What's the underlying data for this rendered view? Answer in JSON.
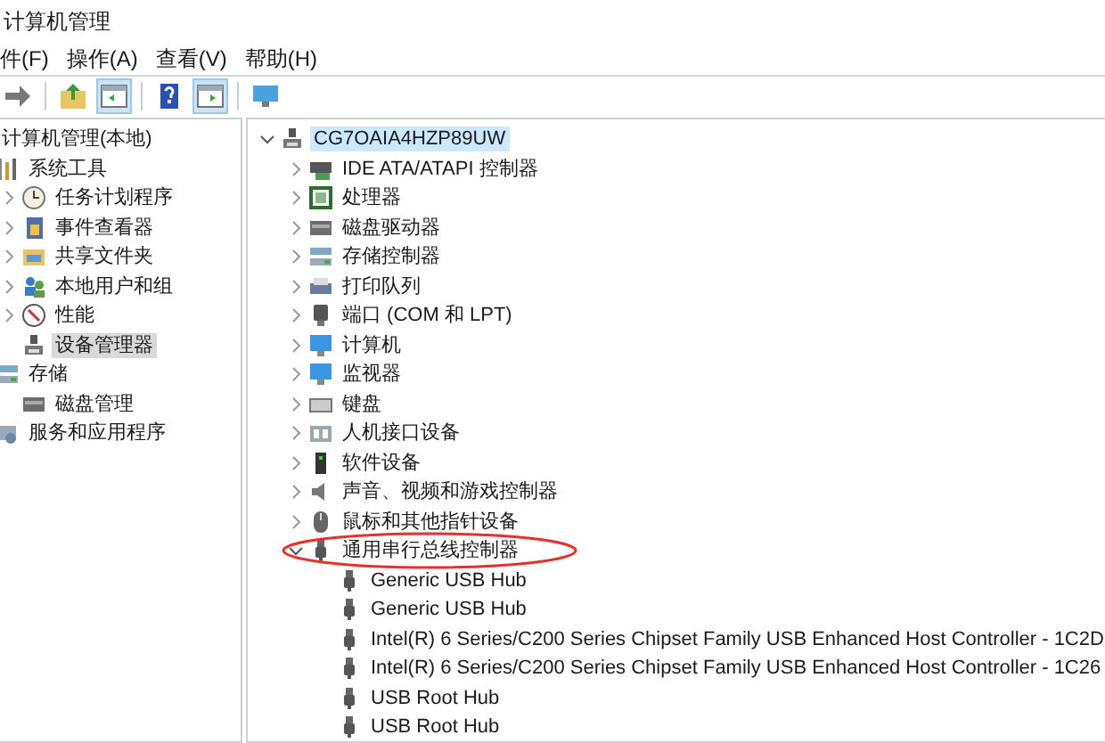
{
  "window": {
    "title": "计算机管理"
  },
  "menu": [
    {
      "label": "件(F)"
    },
    {
      "label": "操作(A)"
    },
    {
      "label": "查看(V)"
    },
    {
      "label": "帮助(H)"
    }
  ],
  "toolbar": [
    {
      "kind": "forward",
      "selected": false
    },
    {
      "kind": "up",
      "selected": false
    },
    {
      "kind": "pane",
      "selected": true
    },
    {
      "kind": "help",
      "selected": false
    },
    {
      "kind": "action",
      "selected": true
    },
    {
      "kind": "monitor",
      "selected": false
    }
  ],
  "navigation_tree": [
    {
      "label": "计算机管理(本地)",
      "selected": false,
      "children": [
        {
          "label": "系统工具",
          "kind": "tools",
          "selected": false,
          "children": [
            {
              "label": "任务计划程序",
              "kind": "clock",
              "expanded": false,
              "selected": false
            },
            {
              "label": "事件查看器",
              "kind": "log",
              "expanded": false,
              "selected": false
            },
            {
              "label": "共享文件夹",
              "kind": "folder",
              "expanded": false,
              "selected": false
            },
            {
              "label": "本地用户和组",
              "kind": "users",
              "expanded": false,
              "selected": false
            },
            {
              "label": "性能",
              "kind": "gauge",
              "expanded": false,
              "selected": false
            },
            {
              "label": "设备管理器",
              "kind": "device",
              "selected": true
            }
          ]
        },
        {
          "label": "存储",
          "kind": "storage",
          "selected": false,
          "children": [
            {
              "label": "磁盘管理",
              "kind": "drive",
              "selected": false
            }
          ]
        },
        {
          "label": "服务和应用程序",
          "kind": "services",
          "selected": false
        }
      ]
    }
  ],
  "device_tree": [
    {
      "label": "CG7OAIA4HZP89UW",
      "kind": "device",
      "expanded": true,
      "selected": true,
      "children": [
        {
          "label": "IDE ATA/ATAPI 控制器",
          "kind": "ide",
          "expanded": false,
          "selected": false
        },
        {
          "label": "处理器",
          "kind": "cpu",
          "expanded": false,
          "selected": false
        },
        {
          "label": "磁盘驱动器",
          "kind": "drive",
          "expanded": false,
          "selected": false
        },
        {
          "label": "存储控制器",
          "kind": "storage",
          "expanded": false,
          "selected": false
        },
        {
          "label": "打印队列",
          "kind": "printer",
          "expanded": false,
          "selected": false
        },
        {
          "label": "端口 (COM 和 LPT)",
          "kind": "port",
          "expanded": false,
          "selected": false
        },
        {
          "label": "计算机",
          "kind": "monitor",
          "expanded": false,
          "selected": false
        },
        {
          "label": "监视器",
          "kind": "monitor",
          "expanded": false,
          "selected": false
        },
        {
          "label": "键盘",
          "kind": "keyboard",
          "expanded": false,
          "selected": false
        },
        {
          "label": "人机接口设备",
          "kind": "hid",
          "expanded": false,
          "selected": false
        },
        {
          "label": "软件设备",
          "kind": "software",
          "expanded": false,
          "selected": false
        },
        {
          "label": "声音、视频和游戏控制器",
          "kind": "sound",
          "expanded": false,
          "selected": false
        },
        {
          "label": "鼠标和其他指针设备",
          "kind": "mouse",
          "expanded": false,
          "selected": false
        },
        {
          "label": "通用串行总线控制器",
          "kind": "usb",
          "expanded": true,
          "selected": false,
          "children": [
            {
              "label": "Generic USB Hub",
              "kind": "usb",
              "selected": false
            },
            {
              "label": "Generic USB Hub",
              "kind": "usb",
              "selected": false
            },
            {
              "label": "Intel(R) 6 Series/C200 Series Chipset Family USB Enhanced Host Controller - 1C2D",
              "kind": "usb",
              "selected": false
            },
            {
              "label": "Intel(R) 6 Series/C200 Series Chipset Family USB Enhanced Host Controller - 1C26",
              "kind": "usb",
              "selected": false
            },
            {
              "label": "USB Root Hub",
              "kind": "usb",
              "selected": false
            },
            {
              "label": "USB Root Hub",
              "kind": "usb",
              "selected": false
            }
          ]
        }
      ]
    }
  ],
  "annotation": {
    "kind": "ellipse",
    "color": "#e8302a"
  }
}
